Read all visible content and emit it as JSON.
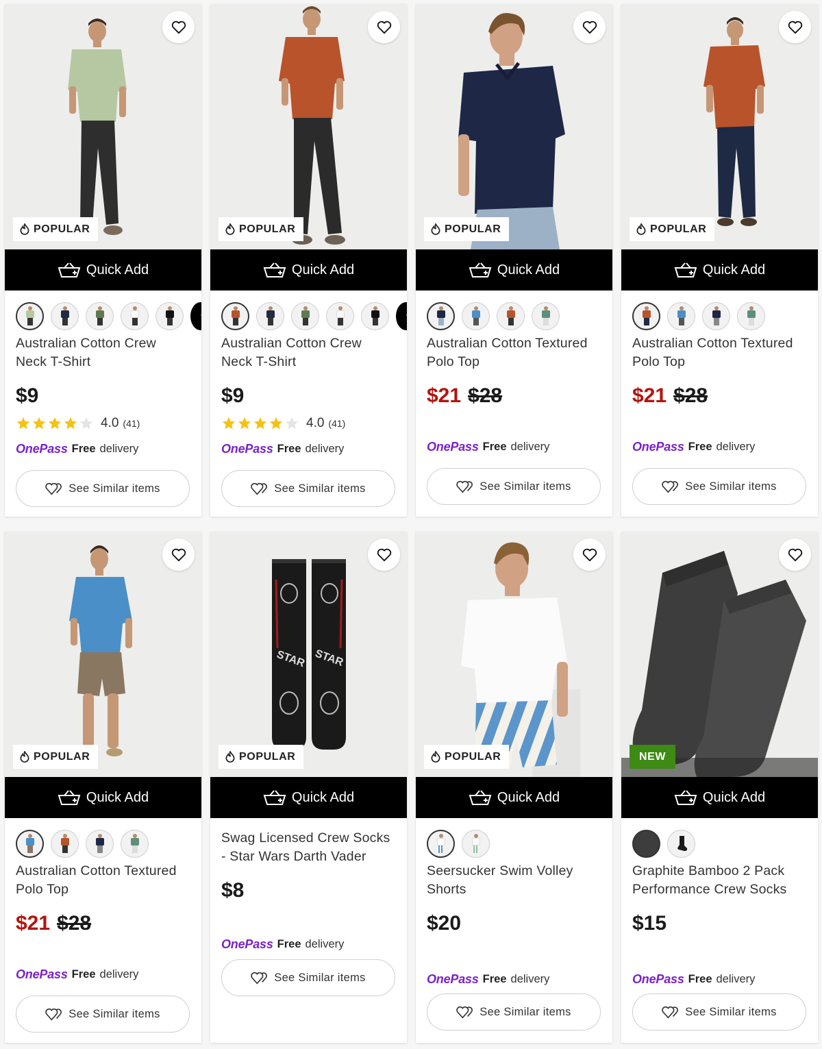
{
  "quick_add_label": "Quick Add",
  "see_similar_label": "See Similar items",
  "delivery": {
    "brand": "OnePass",
    "free": "Free",
    "text": "delivery"
  },
  "colors": {
    "sale": "#b3140f",
    "onepass": "#7a22c7",
    "new_badge": "#3d8a14",
    "star": "#f5c211"
  },
  "products": [
    {
      "badge": "POPULAR",
      "title": "Australian Cotton Crew Neck T-Shirt",
      "price": "$9",
      "rating": "4.0",
      "reviews": "(41)",
      "stars": 4,
      "swatches": [
        "sage",
        "navy",
        "olive",
        "white",
        "black"
      ],
      "more_swatches": true
    },
    {
      "badge": "POPULAR",
      "title": "Australian Cotton Crew Neck T-Shirt",
      "price": "$9",
      "rating": "4.0",
      "reviews": "(41)",
      "stars": 4,
      "swatches": [
        "rust",
        "navy",
        "olive",
        "white",
        "black"
      ],
      "more_swatches": true
    },
    {
      "badge": "POPULAR",
      "title": "Australian Cotton Textured Polo Top",
      "price": "$21",
      "was": "$28",
      "swatches": [
        "navy",
        "blue",
        "rust",
        "green"
      ]
    },
    {
      "badge": "POPULAR",
      "title": "Australian Cotton Textured Polo Top",
      "price": "$21",
      "was": "$28",
      "swatches": [
        "rust",
        "blue",
        "navy",
        "green"
      ]
    },
    {
      "badge": "POPULAR",
      "title": "Australian Cotton Textured Polo Top",
      "price": "$21",
      "was": "$28",
      "swatches": [
        "blue",
        "rust",
        "navy",
        "green"
      ]
    },
    {
      "badge": "POPULAR",
      "title": "Swag Licensed Crew Socks - Star Wars Darth Vader",
      "price": "$8",
      "swatches": []
    },
    {
      "badge": "POPULAR",
      "title": "Seersucker Swim Volley Shorts",
      "price": "$20",
      "swatches": [
        "stripe-blue",
        "stripe-green"
      ]
    },
    {
      "badge": "NEW",
      "title": "Graphite Bamboo 2 Pack Performance Crew Socks",
      "price": "$15",
      "swatches": [
        "charcoal",
        "black"
      ]
    }
  ]
}
